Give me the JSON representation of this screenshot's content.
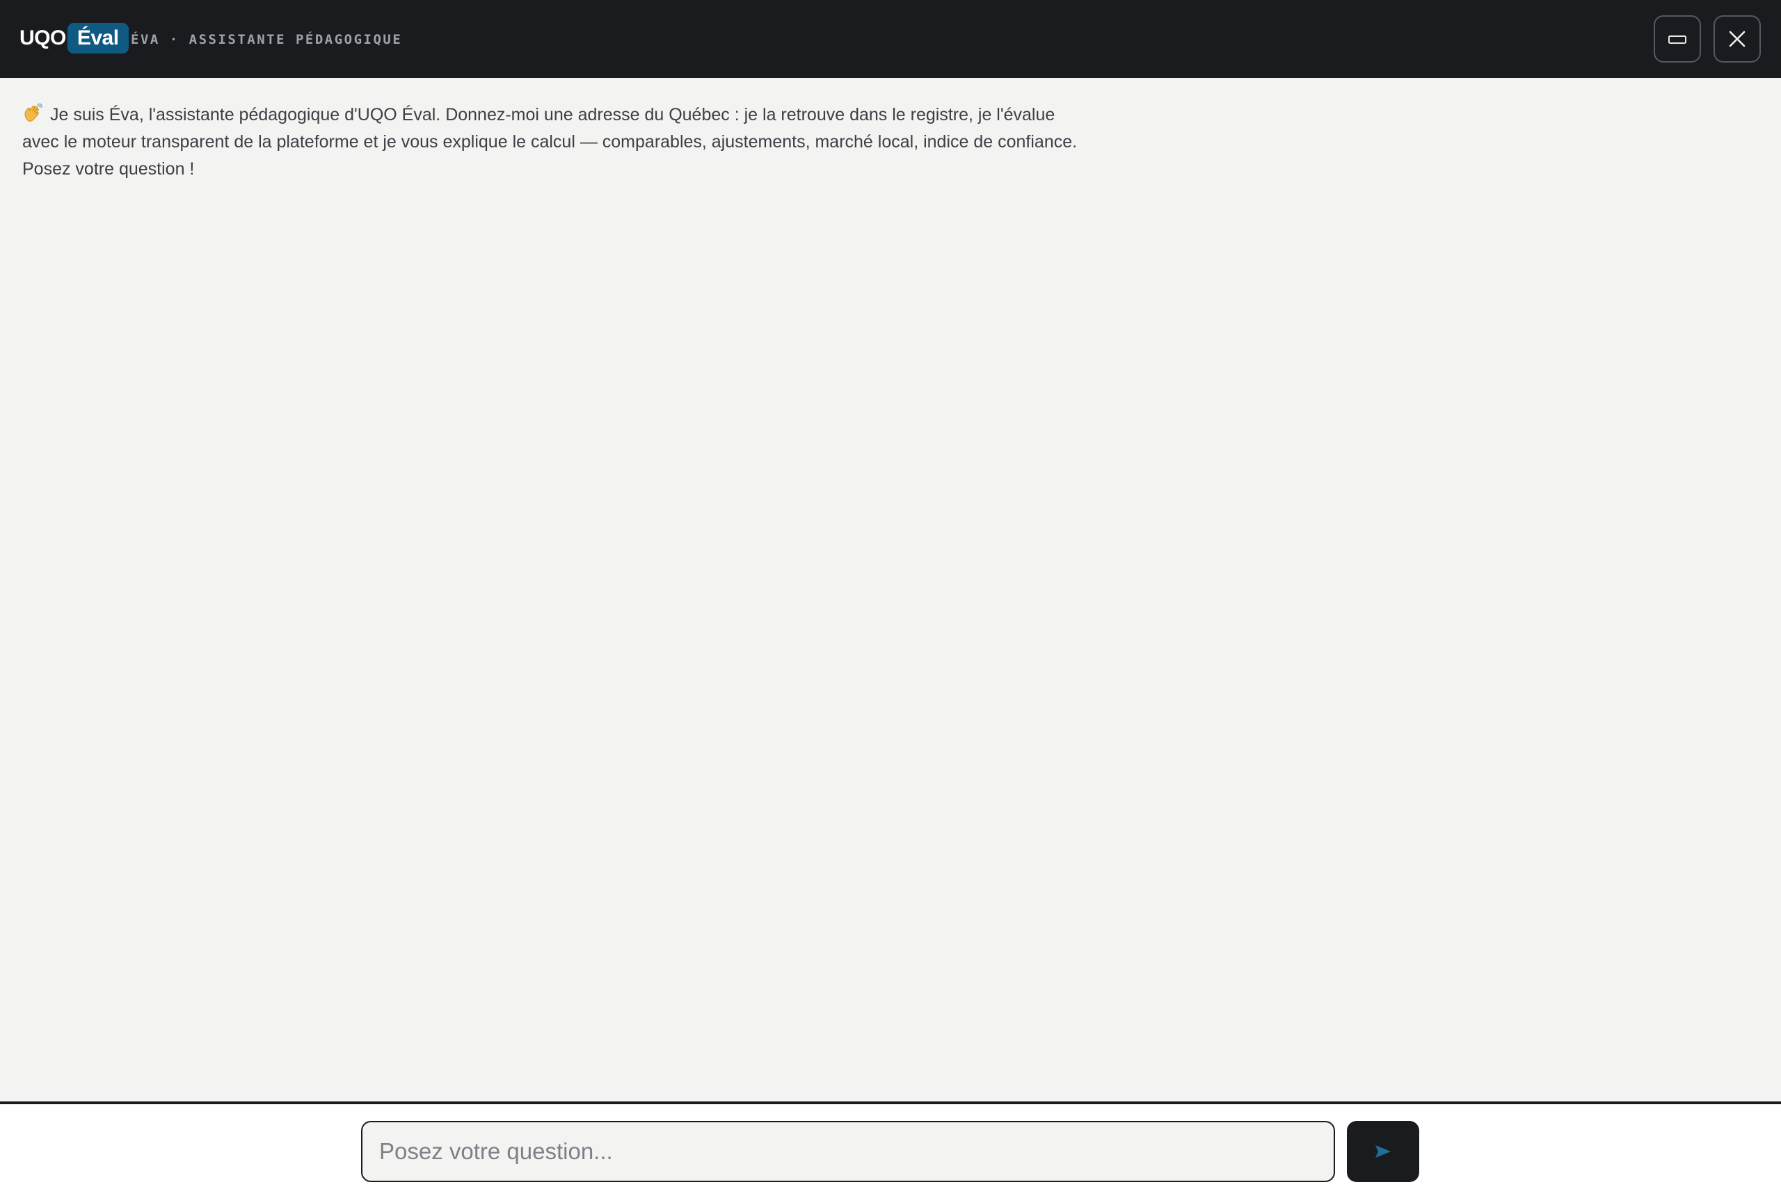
{
  "header": {
    "logo_text": "UQO",
    "logo_badge": "Éval",
    "subtitle": "ÉVA · ASSISTANTE PÉDAGOGIQUE",
    "minimize_icon": "minimize-icon",
    "close_icon": "close-icon"
  },
  "chat": {
    "messages": [
      {
        "icon": "waving-hand-icon",
        "text": "Je suis Éva, l'assistante pédagogique d'UQO Éval. Donnez-moi une adresse du Québec : je la retrouve dans le registre, je l'évalue avec le moteur transparent de la plateforme et je vous explique le calcul — comparables, ajustements, marché local, indice de confiance. Posez votre question !"
      }
    ]
  },
  "composer": {
    "placeholder": "Posez votre question...",
    "value": "",
    "send_icon": "send-arrow-icon"
  },
  "colors": {
    "header_bg": "#1a1b1e",
    "brand_accent": "#0f5a82",
    "chat_bg": "#f3f3f1",
    "send_arrow": "#1e6f9c"
  }
}
